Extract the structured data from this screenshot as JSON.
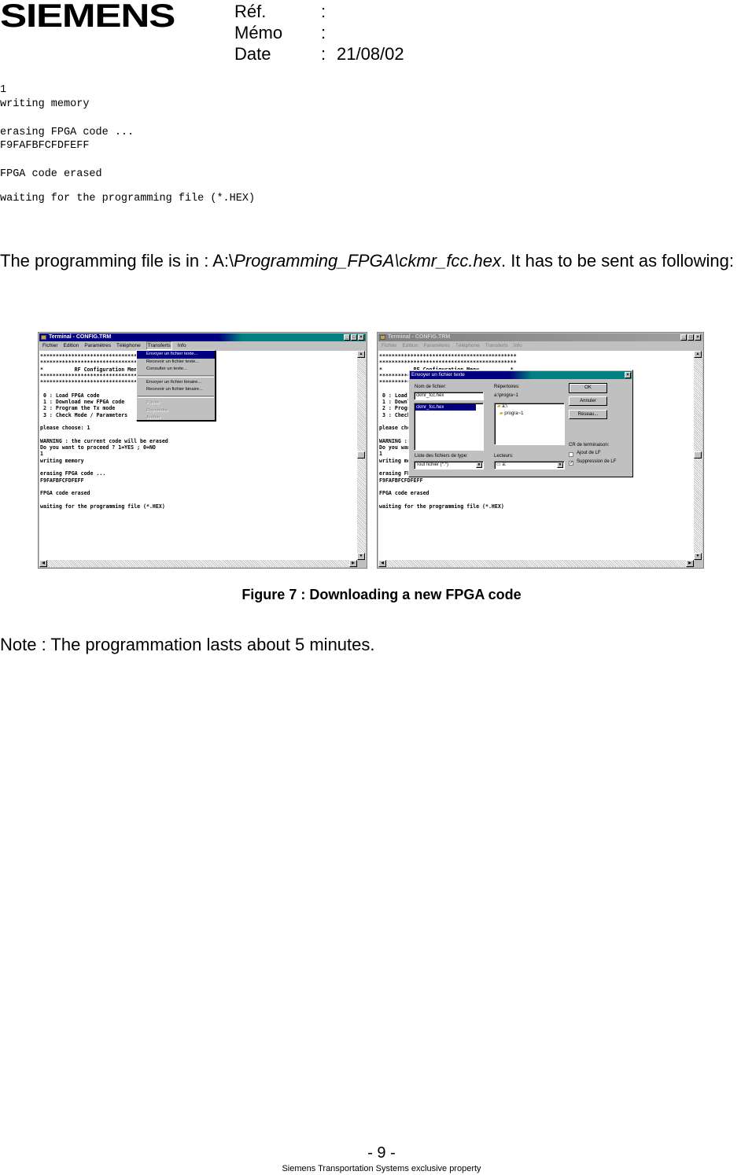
{
  "header": {
    "logo": "SIEMENS",
    "ref_label": "Réf.",
    "ref_value": "",
    "memo_label": "Mémo",
    "memo_value": "",
    "date_label": "Date",
    "date_value": "21/08/02",
    "colon": ":"
  },
  "console_output": {
    "lines": [
      "1",
      "writing memory",
      "erasing FPGA code ...",
      "F9FAFBFCFDFEFF",
      "FPGA code erased",
      "waiting for the programming file (*.HEX)"
    ]
  },
  "paragraph": {
    "prefix": "The programming file is in : ",
    "path_drive": "A:\\",
    "path_rest": "Programming_FPGA\\ckmr_fcc.hex",
    "suffix": ". It has to be sent as following:"
  },
  "figure": {
    "left_window": {
      "title": "Terminal - CONFIG.TRM",
      "menu": [
        "Fichier",
        "Edition",
        "Paramètres",
        "Téléphone",
        "Transferts",
        "Info"
      ],
      "active_menu": "Transferts",
      "dropdown": [
        {
          "label": "Envoyer un fichier texte...",
          "state": "highlighted"
        },
        {
          "label": "Recevoir un fichier texte...",
          "state": "normal"
        },
        {
          "label": "Consulter un texte...",
          "state": "normal"
        },
        {
          "label": "Envoyer un fichier binaire...",
          "state": "normal"
        },
        {
          "label": "Recevoir un fichier binaire...",
          "state": "normal"
        },
        {
          "label": "Pause",
          "state": "disabled"
        },
        {
          "label": "Reprendre",
          "state": "disabled"
        },
        {
          "label": "Arrêter",
          "state": "disabled"
        }
      ],
      "terminal_text": "********************************************\n********************************************\n*          RF Configuration Menu          *\n********************************************\n********************************************\n\n 0 : Load FPGA code\n 1 : Download new FPGA code\n 2 : Program the Tx mode\n 3 : Check Mode / Parameters\n\nplease choose: 1\n\nWARNING : the current code will be erased\nDo you want to proceed ? 1=YES ; 0=NO\n1\nwriting memory\n\nerasing FPGA code ...\nF9FAFBFCFDFEFF\n\nFPGA code erased\n\nwaiting for the programming file (*.HEX)"
    },
    "right_window": {
      "title": "Terminal - CONFIG.TRM",
      "menu": [
        "Fichier",
        "Edition",
        "Paramètres",
        "Téléphone",
        "Transferts",
        "Info"
      ],
      "terminal_text": "********************************************\n********************************************\n*          RF Configuration Menu          *\n********************************************\n********************************************\n\n 0 : Load FPGA code\n 1 : Download new FPGA code\n 2 : Program the Tx mode\n 3 : Check Mode / Parameters\n\nplease choose: 1\n\nWARNING : the current code will be erased\nDo you want to proceed ? 1=YES ; 0=NO\n1\nwriting memory\n\nerasing FPGA code ...\nF9FAFBFCFDFEFF\n\nFPGA code erased\n\nwaiting for the programming file (*.HEX)",
      "dialog": {
        "title": "Envoyer un fichier texte",
        "filename_label": "Nom de fichier:",
        "filename_value": "ckmr_fcc.hex",
        "file_list": [
          "ckmr_fcc.hex"
        ],
        "dirs_label": "Répertoires:",
        "current_dir": "a:\\progra~1",
        "dir_tree": [
          "a:\\",
          "progra~1"
        ],
        "type_label": "Liste des fichiers de type:",
        "type_value": "Tout fichier (*.*)",
        "drives_label": "Lecteurs:",
        "drive_value": "a:",
        "ok": "OK",
        "cancel": "Annuler",
        "network": "Réseau...",
        "cr_label": "CR de terminaison:",
        "add_lf": "Ajout de LF",
        "add_lf_checked": false,
        "remove_lf": "Suppression de LF",
        "remove_lf_checked": true
      }
    },
    "caption": "Figure 7 : Downloading a new FPGA code"
  },
  "note": "Note : The programmation lasts about 5 minutes.",
  "footer": {
    "page": "- 9 -",
    "property": "Siemens Transportation Systems exclusive property"
  }
}
